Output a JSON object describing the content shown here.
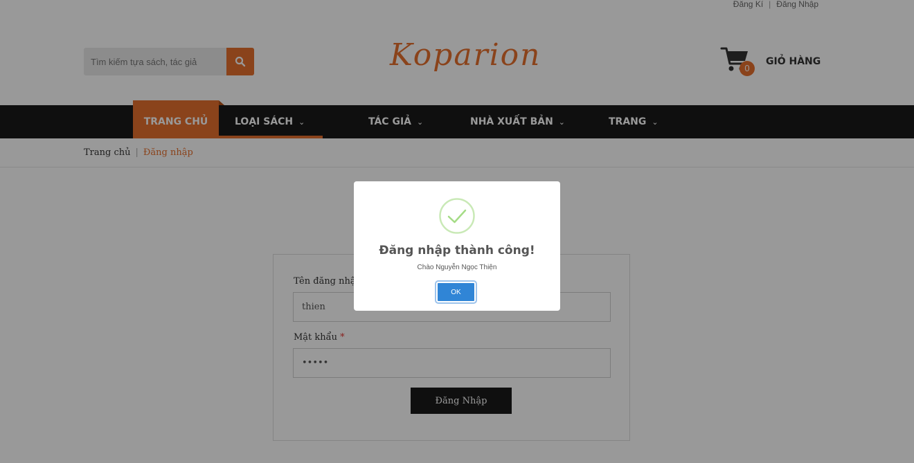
{
  "topbar": {
    "register": "Đăng Kí",
    "separator": "|",
    "login": "Đăng Nhập"
  },
  "header": {
    "search_placeholder": "Tìm kiếm tựa sách, tác giả",
    "logo": "Koparion",
    "cart_count": "0",
    "cart_label": "GIỎ HÀNG"
  },
  "nav": {
    "items": [
      {
        "label": "TRANG CHỦ",
        "active": true
      },
      {
        "label": "LOẠI SÁCH",
        "chevron": "chevron-down-icon"
      },
      {
        "label": "TÁC GIẢ",
        "chevron": "chevron-down-icon"
      },
      {
        "label": "NHÀ XUẤT BẢN",
        "chevron": "chevron-down-icon"
      },
      {
        "label": "TRANG",
        "chevron": "chevron-down-icon"
      }
    ],
    "chevron_glyph": "⌄"
  },
  "breadcrumb": {
    "home": "Trang chủ",
    "separator": "|",
    "current": "Đăng nhập"
  },
  "login_form": {
    "username_label": "Tên đăng nhập",
    "username_value": "thien",
    "password_label": "Mật khẩu",
    "required_mark": "*",
    "password_value": "•••••",
    "submit_label": "Đăng Nhập"
  },
  "modal": {
    "title": "Đăng nhập thành công!",
    "message": "Chào Nguyễn Ngọc Thiện",
    "ok_label": "OK"
  },
  "colors": {
    "accent": "#e7702e",
    "nav_bg": "#1a1a1a",
    "ok_button": "#3085d6",
    "success_check": "#a5dc86"
  }
}
